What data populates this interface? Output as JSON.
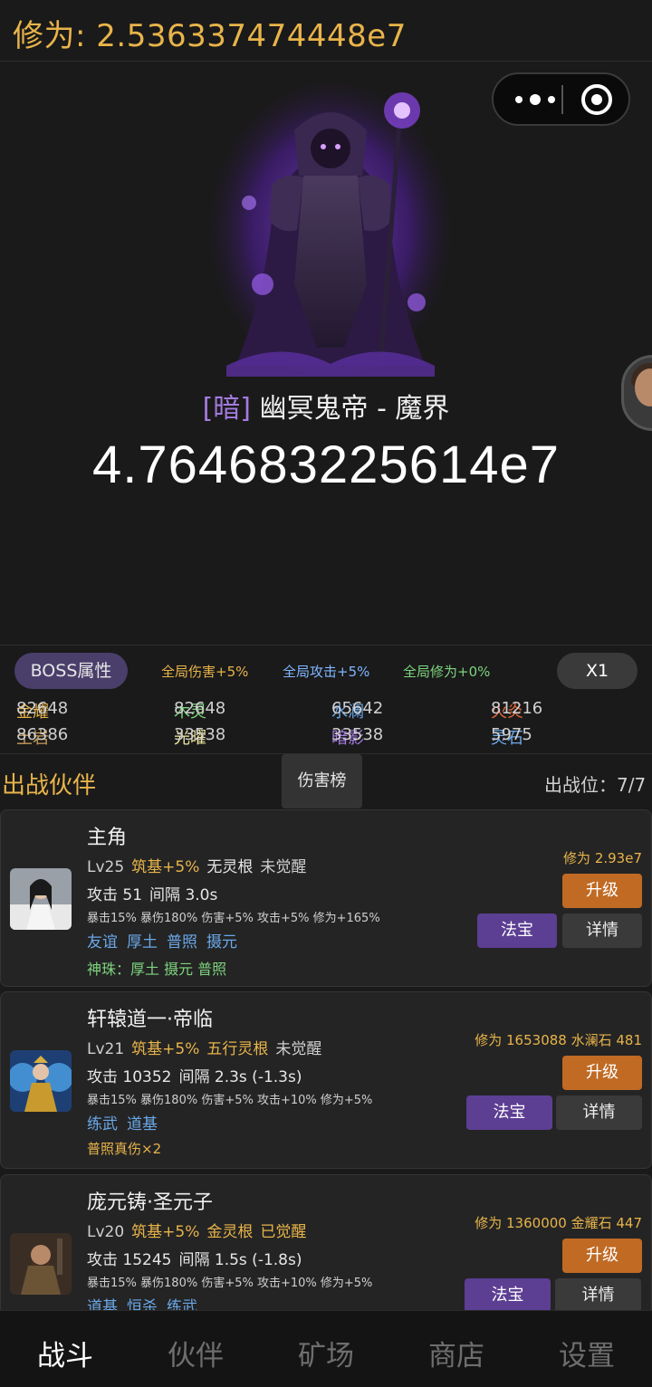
{
  "header": {
    "cultivation": "修为: 2.536337474448e7"
  },
  "boss": {
    "element": "[暗]",
    "name": "幽冥鬼帝 - 魔界",
    "hp": "4.764683225614e7"
  },
  "boss_bar": {
    "attr_button": "BOSS属性",
    "buffs": [
      {
        "text": "全局伤害+5%",
        "color": "#e8b44a"
      },
      {
        "text": "全局攻击+5%",
        "color": "#7fb6ff"
      },
      {
        "text": "全局修为+0%",
        "color": "#7ed47e"
      }
    ],
    "speed_button": "X1"
  },
  "resources": [
    {
      "label": "金耀",
      "value": "82648",
      "color": "#e8b44a"
    },
    {
      "label": "木灵",
      "value": "82648",
      "color": "#7ed47e"
    },
    {
      "label": "水澜",
      "value": "65642",
      "color": "#6aa8e8"
    },
    {
      "label": "火炎",
      "value": "81216",
      "color": "#e8693a"
    },
    {
      "label": "土岩",
      "value": "86386",
      "color": "#c49a5a"
    },
    {
      "label": "光曜",
      "value": "33538",
      "color": "#f0e6a0"
    },
    {
      "label": "暗影",
      "value": "33538",
      "color": "#a47be0"
    },
    {
      "label": "灵石",
      "value": "5975",
      "color": "#6aa8e8"
    }
  ],
  "section": {
    "title": "出战伙伴",
    "rank_button": "伤害榜",
    "slots": "出战位：7/7"
  },
  "partners": [
    {
      "name": "主角",
      "level": "Lv25",
      "realm": "筑基+5%",
      "root": "无灵根",
      "awaken": "未觉醒",
      "attack": "攻击 51",
      "interval": "间隔 3.0s",
      "stats": "暴击15% 暴伤180% 伤害+5% 攻击+5% 修为+165%",
      "skills": [
        "友谊",
        "厚土",
        "普照",
        "摄元"
      ],
      "note": "神珠：厚土 摄元 普照",
      "xiuwei": "修为 2.93e7",
      "upgrade": "升级",
      "treasure": "法宝",
      "detail": "详情"
    },
    {
      "name": "轩辕道一·帝临",
      "level": "Lv21",
      "realm": "筑基+5%",
      "root": "五行灵根",
      "awaken": "未觉醒",
      "attack": "攻击 10352",
      "interval": "间隔 2.3s (-1.3s)",
      "stats": "暴击15% 暴伤180% 伤害+5% 攻击+10% 修为+5%",
      "skills": [
        "练武",
        "道基"
      ],
      "note": "普照真伤×2",
      "xiuwei": "修为 1653088  水澜石 481",
      "upgrade": "升级",
      "treasure": "法宝",
      "detail": "详情"
    },
    {
      "name": "庞元铸·圣元子",
      "level": "Lv20",
      "realm": "筑基+5%",
      "root": "金灵根",
      "awaken": "已觉醒",
      "attack": "攻击 15245",
      "interval": "间隔 1.5s (-1.8s)",
      "stats": "暴击15% 暴伤180% 伤害+5% 攻击+10% 修为+5%",
      "skills": [
        "道基",
        "恒杀",
        "练武"
      ],
      "note": "",
      "xiuwei": "修为 1360000  金耀石 447",
      "upgrade": "升级",
      "treasure": "法宝",
      "detail": "详情"
    }
  ],
  "tabs": [
    "战斗",
    "伙伴",
    "矿场",
    "商店",
    "设置"
  ],
  "colors": {
    "gold": "#e8b44a",
    "purple_button": "#5c3e93",
    "orange_button": "#c06a24",
    "background": "#1a1a1a"
  }
}
